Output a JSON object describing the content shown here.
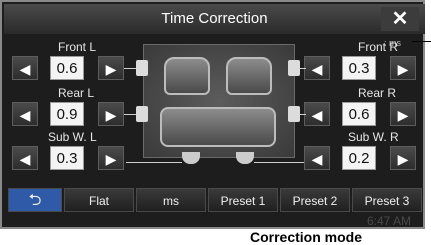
{
  "title": "Time Correction",
  "close_icon": "close-icon",
  "unit_label": ": ms",
  "seats": {
    "front_l": {
      "label": "Front L",
      "value": "0.6"
    },
    "front_r": {
      "label": "Front R",
      "value": "0.3"
    },
    "rear_l": {
      "label": "Rear L",
      "value": "0.9"
    },
    "rear_r": {
      "label": "Rear R",
      "value": "0.6"
    },
    "sub_l": {
      "label": "Sub W. L",
      "value": "0.3"
    },
    "sub_r": {
      "label": "Sub W. R",
      "value": "0.2"
    }
  },
  "arrows": {
    "left": "◀",
    "right": "▶"
  },
  "bottom_bar": {
    "back_icon": "back-arrow-icon",
    "flat": "Flat",
    "ms": "ms",
    "preset1": "Preset 1",
    "preset2": "Preset 2",
    "preset3": "Preset 3"
  },
  "clock": "6:47 AM",
  "caption": "Correction mode"
}
